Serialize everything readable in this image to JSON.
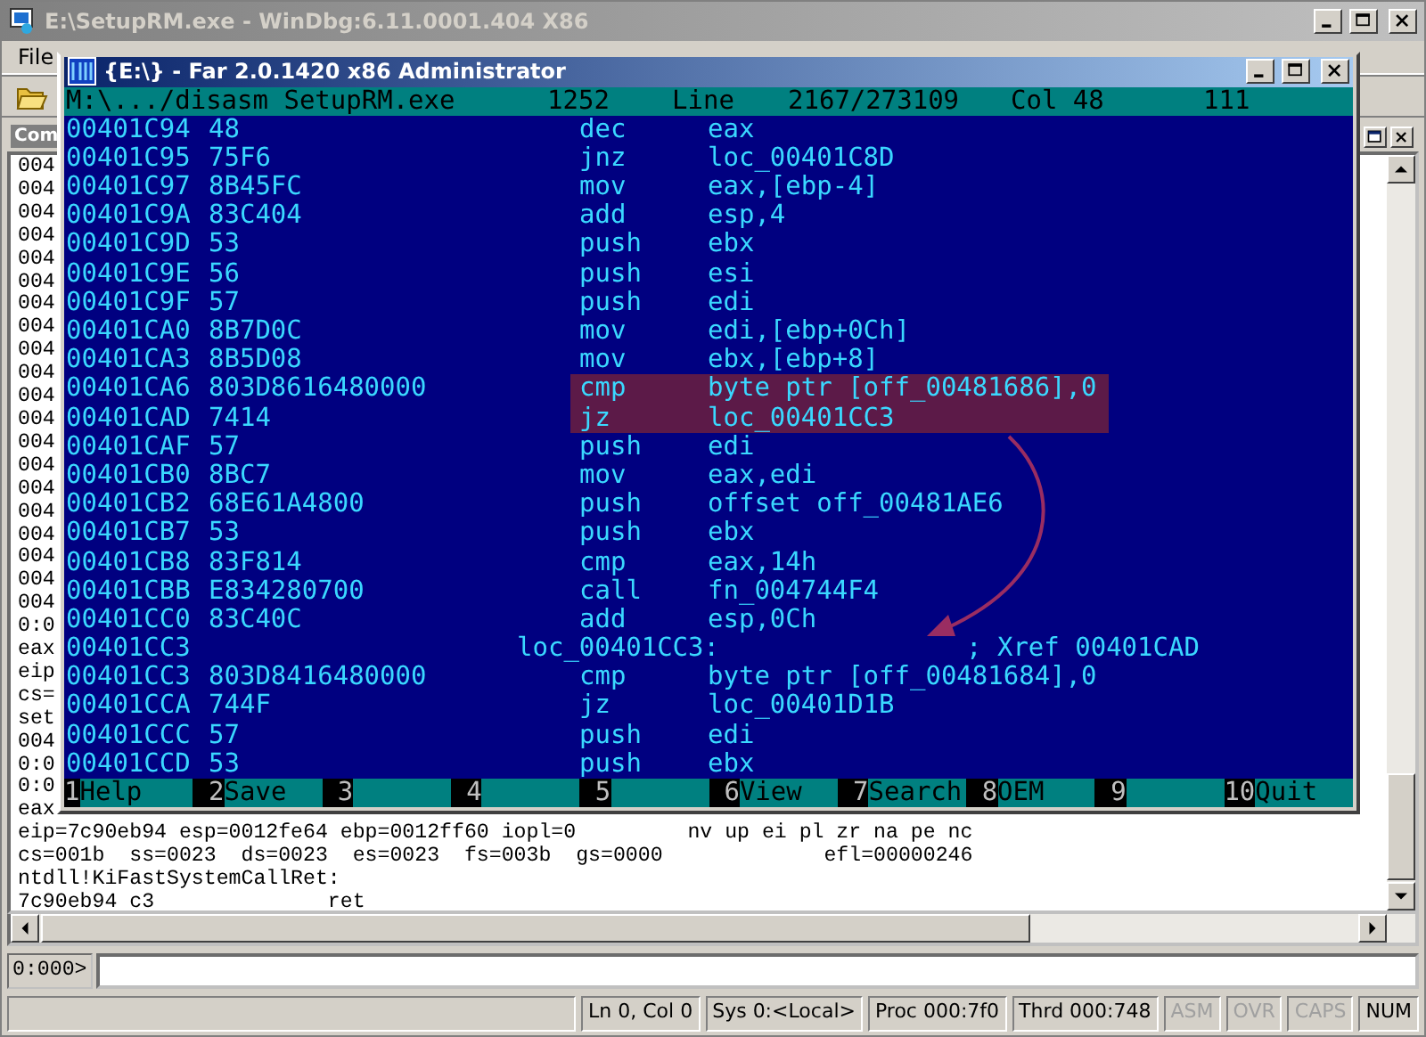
{
  "windbg": {
    "title": "E:\\SetupRM.exe - WinDbg:6.11.0001.404 X86",
    "menu": [
      "File"
    ],
    "command_window": {
      "title": "Com",
      "output": [
        "004",
        "004",
        "004",
        "004",
        "004",
        "004",
        "004",
        "004",
        "004",
        "004",
        "004",
        "004",
        "004",
        "004",
        "004",
        "004",
        "004",
        "004",
        "004",
        "004",
        "0:0",
        "eax",
        "eip",
        "cs=",
        "set",
        "004",
        "0:0",
        "0:0",
        "eax",
        "eip=7c90eb94 esp=0012fe64 ebp=0012ff60 iopl=0         nv up ei pl zr na pe nc",
        "cs=001b  ss=0023  ds=0023  es=0023  fs=003b  gs=0000             efl=00000246",
        "ntdll!KiFastSystemCallRet:",
        "7c90eb94 c3              ret"
      ],
      "prompt": "0:000>"
    },
    "status_bar": [
      {
        "text": "Ln 0, Col 0",
        "disabled": false
      },
      {
        "text": "Sys 0:<Local>",
        "disabled": false
      },
      {
        "text": "Proc 000:7f0",
        "disabled": false
      },
      {
        "text": "Thrd 000:748",
        "disabled": false
      },
      {
        "text": "ASM",
        "disabled": true
      },
      {
        "text": "OVR",
        "disabled": true
      },
      {
        "text": "CAPS",
        "disabled": true
      },
      {
        "text": "NUM",
        "disabled": false
      }
    ]
  },
  "far": {
    "title": "{E:\\} - Far 2.0.1420 x86 Administrator",
    "status": {
      "file": "M:\\.../disasm SetupRM.exe",
      "codepage": "1252",
      "line_label": "Line",
      "line": "2167/273109",
      "col": "Col 48",
      "char": "111"
    },
    "rows": [
      {
        "kind": "code",
        "address": "00401C94",
        "bytes": "48",
        "mnemonic": "dec",
        "operand": "eax",
        "highlighted": false
      },
      {
        "kind": "code",
        "address": "00401C95",
        "bytes": "75F6",
        "mnemonic": "jnz",
        "operand": "loc_00401C8D",
        "highlighted": false
      },
      {
        "kind": "code",
        "address": "00401C97",
        "bytes": "8B45FC",
        "mnemonic": "mov",
        "operand": "eax,[ebp-4]",
        "highlighted": false
      },
      {
        "kind": "code",
        "address": "00401C9A",
        "bytes": "83C404",
        "mnemonic": "add",
        "operand": "esp,4",
        "highlighted": false
      },
      {
        "kind": "code",
        "address": "00401C9D",
        "bytes": "53",
        "mnemonic": "push",
        "operand": "ebx",
        "highlighted": false
      },
      {
        "kind": "code",
        "address": "00401C9E",
        "bytes": "56",
        "mnemonic": "push",
        "operand": "esi",
        "highlighted": false
      },
      {
        "kind": "code",
        "address": "00401C9F",
        "bytes": "57",
        "mnemonic": "push",
        "operand": "edi",
        "highlighted": false
      },
      {
        "kind": "code",
        "address": "00401CA0",
        "bytes": "8B7D0C",
        "mnemonic": "mov",
        "operand": "edi,[ebp+0Ch]",
        "highlighted": false
      },
      {
        "kind": "code",
        "address": "00401CA3",
        "bytes": "8B5D08",
        "mnemonic": "mov",
        "operand": "ebx,[ebp+8]",
        "highlighted": false
      },
      {
        "kind": "code",
        "address": "00401CA6",
        "bytes": "803D8616480000",
        "mnemonic": "cmp",
        "operand": "byte ptr [off_00481686],0",
        "highlighted": true
      },
      {
        "kind": "code",
        "address": "00401CAD",
        "bytes": "7414",
        "mnemonic": "jz",
        "operand": "loc_00401CC3",
        "highlighted": true
      },
      {
        "kind": "code",
        "address": "00401CAF",
        "bytes": "57",
        "mnemonic": "push",
        "operand": "edi",
        "highlighted": false
      },
      {
        "kind": "code",
        "address": "00401CB0",
        "bytes": "8BC7",
        "mnemonic": "mov",
        "operand": "eax,edi",
        "highlighted": false
      },
      {
        "kind": "code",
        "address": "00401CB2",
        "bytes": "68E61A4800",
        "mnemonic": "push",
        "operand": "offset off_00481AE6",
        "highlighted": false
      },
      {
        "kind": "code",
        "address": "00401CB7",
        "bytes": "53",
        "mnemonic": "push",
        "operand": "ebx",
        "highlighted": false
      },
      {
        "kind": "code",
        "address": "00401CB8",
        "bytes": "83F814",
        "mnemonic": "cmp",
        "operand": "eax,14h",
        "highlighted": false
      },
      {
        "kind": "code",
        "address": "00401CBB",
        "bytes": "E834280700",
        "mnemonic": "call",
        "operand": "fn_004744F4",
        "highlighted": false
      },
      {
        "kind": "code",
        "address": "00401CC0",
        "bytes": "83C40C",
        "mnemonic": "add",
        "operand": "esp,0Ch",
        "highlighted": false
      },
      {
        "kind": "label",
        "address": "00401CC3",
        "label": "loc_00401CC3:",
        "comment": "; Xref 00401CAD"
      },
      {
        "kind": "code",
        "address": "00401CC3",
        "bytes": "803D8416480000",
        "mnemonic": "cmp",
        "operand": "byte ptr [off_00481684],0",
        "highlighted": false
      },
      {
        "kind": "code",
        "address": "00401CCA",
        "bytes": "744F",
        "mnemonic": "jz",
        "operand": "loc_00401D1B",
        "highlighted": false
      },
      {
        "kind": "code",
        "address": "00401CCC",
        "bytes": "57",
        "mnemonic": "push",
        "operand": "edi",
        "highlighted": false
      },
      {
        "kind": "code",
        "address": "00401CCD",
        "bytes": "53",
        "mnemonic": "push",
        "operand": "ebx",
        "highlighted": false
      }
    ],
    "keybar": [
      {
        "key": "1",
        "label": "Help"
      },
      {
        "key": "2",
        "label": "Save"
      },
      {
        "key": "3"
      },
      {
        "key": "4"
      },
      {
        "key": "5"
      },
      {
        "key": "6",
        "label": "View"
      },
      {
        "key": "7",
        "label": "Search"
      },
      {
        "key": "8",
        "label": "OEM"
      },
      {
        "key": "9"
      },
      {
        "key": "10",
        "label": "Quit"
      }
    ]
  }
}
